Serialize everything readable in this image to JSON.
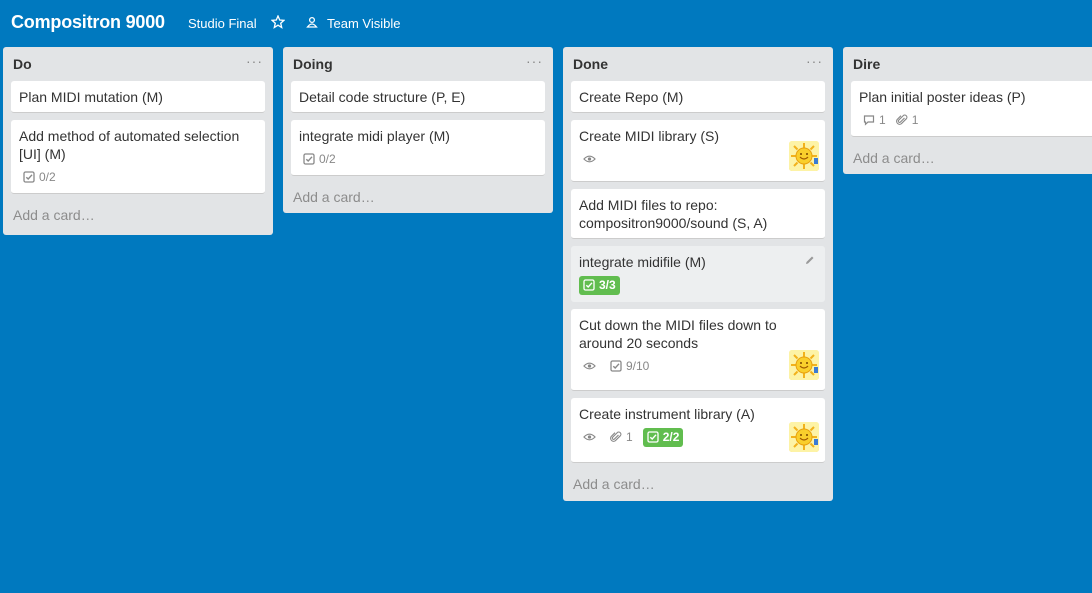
{
  "board": {
    "title": "Compositron 9000",
    "team_menu": "Studio Final",
    "visibility": "Team Visible"
  },
  "colors": {
    "background": "#0079bf",
    "list": "#e2e4e6",
    "complete_badge": "#61bd4f"
  },
  "icons": [
    "star-icon",
    "team-icon",
    "eye-icon",
    "checklist-icon",
    "comment-icon",
    "attachment-icon",
    "pencil-icon",
    "sun-avatar"
  ],
  "lists": [
    {
      "title": "Do",
      "menu": "···",
      "add_card": "Add a card…",
      "cards": [
        {
          "title": "Plan MIDI mutation (M)"
        },
        {
          "title": "Add method of automated selection [UI] (M)",
          "checklist": "0/2"
        }
      ]
    },
    {
      "title": "Doing",
      "menu": "···",
      "add_card": "Add a card…",
      "cards": [
        {
          "title": "Detail code structure (P, E)"
        },
        {
          "title": "integrate midi player (M)",
          "checklist": "0/2"
        }
      ]
    },
    {
      "title": "Done",
      "menu": "···",
      "add_card": "Add a card…",
      "cards": [
        {
          "title": "Create Repo (M)"
        },
        {
          "title": "Create MIDI library (S)"
        },
        {
          "title": "Add MIDI files to repo: compositron9000/sound (S, A)"
        },
        {
          "title": "integrate midifile (M)",
          "checklist": "3/3"
        },
        {
          "title": "Cut down the MIDI files down to around 20 seconds",
          "checklist": "9/10"
        },
        {
          "title": "Create instrument library (A)",
          "attachments": "1",
          "checklist": "2/2"
        }
      ]
    },
    {
      "title": "Dire",
      "menu": "···",
      "add_card": "Add a card…",
      "cards": [
        {
          "title": "Plan initial poster ideas (P)",
          "comments": "1",
          "attachments": "1"
        }
      ]
    }
  ]
}
